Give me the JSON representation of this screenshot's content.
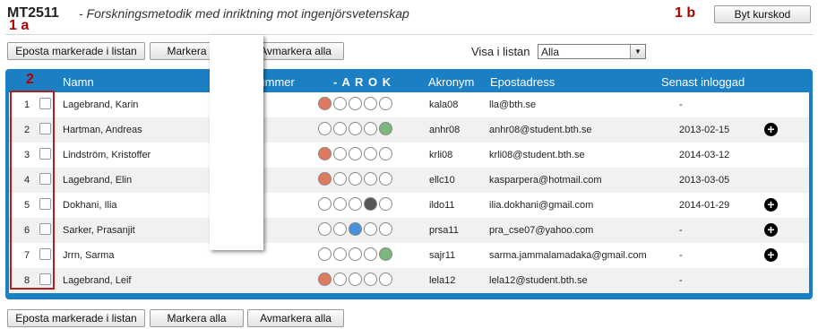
{
  "header": {
    "course_code": "MT2511",
    "course_name": "- Forskningsmetodik med inriktning mot ingenjörsvetenskap",
    "change_button": "Byt kurskod"
  },
  "annotations": {
    "a": "1 a",
    "b": "1 b",
    "c": "2"
  },
  "toolbar": {
    "email_label": "Eposta markerade i listan",
    "mark_all_label": "Markera alla",
    "unmark_all_label": "Avmarkera alla",
    "filter_label": "Visa i listan",
    "filter_value": "Alla"
  },
  "table": {
    "columns": {
      "name": "Namn",
      "pnr": "Personnummer",
      "arok": "- A R O K",
      "acronym": "Akronym",
      "email": "Epostadress",
      "last_login": "Senast inloggad"
    },
    "colors": {
      "A": "#e07a5f",
      "R": "#555555",
      "O": "#4a90d9",
      "K": "#7cb87c"
    },
    "rows": [
      {
        "n": "1",
        "name": "Lagebrand, Karin",
        "status": [
          "A",
          null,
          null,
          null,
          null
        ],
        "acr": "kala08",
        "email": "lla@bth.se",
        "last": "-",
        "plus": false
      },
      {
        "n": "2",
        "name": "Hartman, Andreas",
        "status": [
          null,
          null,
          null,
          null,
          "K"
        ],
        "acr": "anhr08",
        "email": "anhr08@student.bth.se",
        "last": "2013-02-15",
        "plus": true
      },
      {
        "n": "3",
        "name": "Lindström, Kristoffer",
        "status": [
          "A",
          null,
          null,
          null,
          null
        ],
        "acr": "krli08",
        "email": "krli08@student.bth.se",
        "last": "2014-03-12",
        "plus": false
      },
      {
        "n": "4",
        "name": "Lagebrand, Elin",
        "status": [
          "A",
          null,
          null,
          null,
          null
        ],
        "acr": "ellc10",
        "email": "kasparpera@hotmail.com",
        "last": "2013-03-05",
        "plus": false
      },
      {
        "n": "5",
        "name": "Dokhani, Ilia",
        "status": [
          null,
          null,
          null,
          "R",
          null
        ],
        "acr": "ildo11",
        "email": "ilia.dokhani@gmail.com",
        "last": "2014-01-29",
        "plus": true
      },
      {
        "n": "6",
        "name": "Sarker, Prasanjit",
        "status": [
          null,
          null,
          "O",
          null,
          null
        ],
        "acr": "prsa11",
        "email": "pra_cse07@yahoo.com",
        "last": "-",
        "plus": true
      },
      {
        "n": "7",
        "name": "Jrrn, Sarma",
        "status": [
          null,
          null,
          null,
          null,
          "K"
        ],
        "acr": "sajr11",
        "email": "sarma.jammalamadaka@gmail.com",
        "last": "-",
        "plus": true
      },
      {
        "n": "8",
        "name": "Lagebrand, Leif",
        "status": [
          "A",
          null,
          null,
          null,
          null
        ],
        "acr": "lela12",
        "email": "lela12@student.bth.se",
        "last": "-",
        "plus": false
      }
    ]
  }
}
